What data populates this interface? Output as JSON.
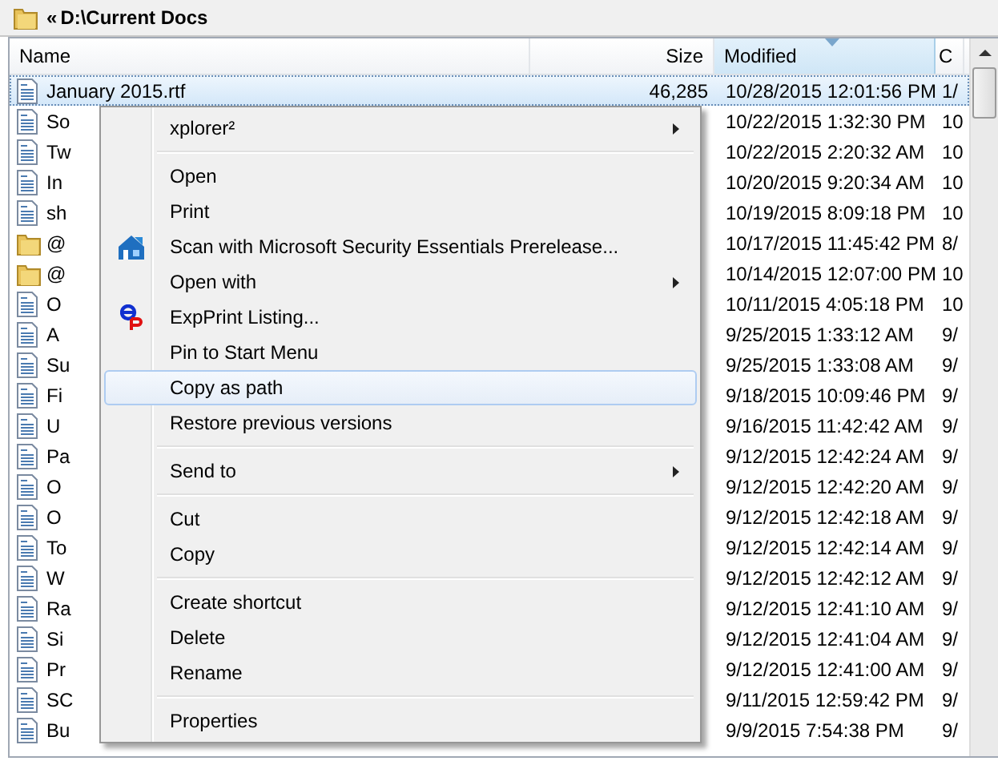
{
  "address_bar": {
    "chevron": "«",
    "path": "D:\\Current Docs"
  },
  "table": {
    "columns": [
      {
        "label": "Name",
        "sorted": false
      },
      {
        "label": "Size",
        "sorted": false
      },
      {
        "label": "Modified",
        "sorted": true
      },
      {
        "label": "C",
        "sorted": false
      }
    ],
    "rows": [
      {
        "kind": "file",
        "name": "January 2015.rtf",
        "size": "46,285",
        "modified": "10/28/2015 12:01:56 PM",
        "column_4": "1/",
        "selected": true
      },
      {
        "kind": "file",
        "name": "So",
        "modified": "10/22/2015 1:32:30 PM",
        "column_4": "10",
        "selected": false
      },
      {
        "kind": "file",
        "name": "Tw",
        "modified": "10/22/2015 2:20:32 AM",
        "column_4": "10",
        "selected": false
      },
      {
        "kind": "file",
        "name": "In",
        "modified": "10/20/2015 9:20:34 AM",
        "column_4": "10",
        "selected": false
      },
      {
        "kind": "file",
        "name": "sh",
        "modified": "10/19/2015 8:09:18 PM",
        "column_4": "10",
        "selected": false
      },
      {
        "kind": "folder",
        "name": "@",
        "modified": "10/17/2015 11:45:42 PM",
        "column_4": "8/",
        "selected": false
      },
      {
        "kind": "folder",
        "name": "@",
        "modified": "10/14/2015 12:07:00 PM",
        "column_4": "10",
        "selected": false
      },
      {
        "kind": "file",
        "name": "O",
        "modified": "10/11/2015 4:05:18 PM",
        "column_4": "10",
        "selected": false
      },
      {
        "kind": "file",
        "name": "A",
        "modified": "9/25/2015 1:33:12 AM",
        "column_4": "9/",
        "selected": false
      },
      {
        "kind": "file",
        "name": "Su",
        "modified": "9/25/2015 1:33:08 AM",
        "column_4": "9/",
        "selected": false
      },
      {
        "kind": "file",
        "name": "Fi",
        "modified": "9/18/2015 10:09:46 PM",
        "column_4": "9/",
        "selected": false
      },
      {
        "kind": "file",
        "name": "U",
        "modified": "9/16/2015 11:42:42 AM",
        "column_4": "9/",
        "selected": false
      },
      {
        "kind": "file",
        "name": "Pa",
        "modified": "9/12/2015 12:42:24 AM",
        "column_4": "9/",
        "selected": false
      },
      {
        "kind": "file",
        "name": "O",
        "modified": "9/12/2015 12:42:20 AM",
        "column_4": "9/",
        "selected": false
      },
      {
        "kind": "file",
        "name": "O",
        "modified": "9/12/2015 12:42:18 AM",
        "column_4": "9/",
        "selected": false
      },
      {
        "kind": "file",
        "name": "To",
        "modified": "9/12/2015 12:42:14 AM",
        "column_4": "9/",
        "selected": false
      },
      {
        "kind": "file",
        "name": "W",
        "modified": "9/12/2015 12:42:12 AM",
        "column_4": "9/",
        "selected": false
      },
      {
        "kind": "file",
        "name": "Ra",
        "modified": "9/12/2015 12:41:10 AM",
        "column_4": "9/",
        "selected": false
      },
      {
        "kind": "file",
        "name": "Si",
        "modified": "9/12/2015 12:41:04 AM",
        "column_4": "9/",
        "selected": false
      },
      {
        "kind": "file",
        "name": "Pr",
        "modified": "9/12/2015 12:41:00 AM",
        "column_4": "9/",
        "selected": false
      },
      {
        "kind": "file",
        "name": "SC",
        "modified": "9/11/2015 12:59:42 PM",
        "column_4": "9/",
        "selected": false
      },
      {
        "kind": "file",
        "name": "Bu",
        "modified": "9/9/2015 7:54:38 PM",
        "column_4": "9/",
        "selected": false
      }
    ]
  },
  "context_menu": {
    "items": [
      {
        "kind": "command",
        "label": "xplorer²",
        "submenu": true,
        "selected": false
      },
      {
        "kind": "separator"
      },
      {
        "kind": "command",
        "label": "Open",
        "submenu": false,
        "selected": false
      },
      {
        "kind": "command",
        "label": "Print",
        "submenu": false,
        "selected": false
      },
      {
        "kind": "antivirus",
        "label": "Scan with Microsoft Security Essentials Prerelease...",
        "submenu": false,
        "selected": false
      },
      {
        "kind": "command",
        "label": "Open with",
        "submenu": true,
        "selected": false
      },
      {
        "kind": "listing",
        "label": "ExpPrint Listing...",
        "submenu": false,
        "selected": false
      },
      {
        "kind": "command",
        "label": "Pin to Start Menu",
        "submenu": false,
        "selected": false
      },
      {
        "kind": "command",
        "label": "Copy as path",
        "submenu": false,
        "selected": true
      },
      {
        "kind": "command",
        "label": "Restore previous versions",
        "submenu": false,
        "selected": false
      },
      {
        "kind": "separator"
      },
      {
        "kind": "command",
        "label": "Send to",
        "submenu": true,
        "selected": false
      },
      {
        "kind": "separator"
      },
      {
        "kind": "command",
        "label": "Cut",
        "submenu": false,
        "selected": false
      },
      {
        "kind": "command",
        "label": "Copy",
        "submenu": false,
        "selected": false
      },
      {
        "kind": "separator"
      },
      {
        "kind": "command",
        "label": "Create shortcut",
        "submenu": false,
        "selected": false
      },
      {
        "kind": "command",
        "label": "Delete",
        "submenu": false,
        "selected": false
      },
      {
        "kind": "command",
        "label": "Rename",
        "submenu": false,
        "selected": false
      },
      {
        "kind": "separator"
      },
      {
        "kind": "command",
        "label": "Properties",
        "submenu": false,
        "selected": false
      }
    ]
  }
}
